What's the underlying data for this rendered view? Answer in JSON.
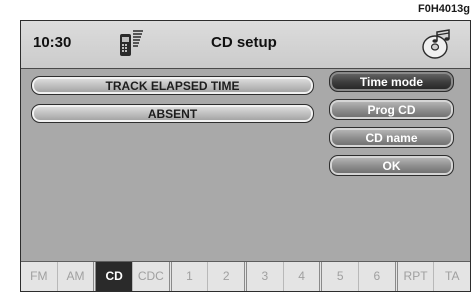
{
  "figure_ref": "F0H4013g",
  "header": {
    "time": "10:30",
    "title": "CD setup",
    "left_icon": "phone-signal-icon",
    "right_icon": "cd-music-icon"
  },
  "info": {
    "line1": "TRACK ELAPSED TIME",
    "line2": "ABSENT"
  },
  "menu": {
    "items": [
      {
        "label": "Time mode",
        "selected": true
      },
      {
        "label": "Prog CD",
        "selected": false
      },
      {
        "label": "CD name",
        "selected": false
      },
      {
        "label": "OK",
        "selected": false
      }
    ]
  },
  "bottom_tabs": [
    {
      "label": "FM",
      "active": false
    },
    {
      "label": "AM",
      "active": false
    },
    {
      "label": "CD",
      "active": true
    },
    {
      "label": "CDC",
      "active": false
    },
    {
      "label": "1",
      "active": false
    },
    {
      "label": "2",
      "active": false
    },
    {
      "label": "3",
      "active": false
    },
    {
      "label": "4",
      "active": false
    },
    {
      "label": "5",
      "active": false
    },
    {
      "label": "6",
      "active": false
    },
    {
      "label": "RPT",
      "active": false
    },
    {
      "label": "TA",
      "active": false
    }
  ],
  "colors": {
    "screen_bg": "#a9a9a9",
    "selected_button": "#3c3c3c",
    "active_tab": "#2a2a2a"
  }
}
